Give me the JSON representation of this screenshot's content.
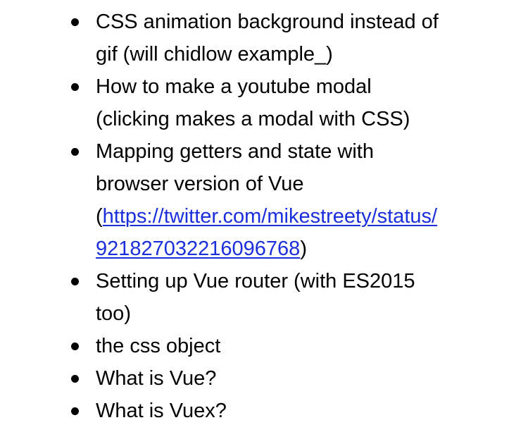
{
  "list": {
    "items": [
      {
        "lines": [
          "CSS animation background instead of",
          "gif (will chidlow example_)"
        ]
      },
      {
        "lines": [
          "How to make a youtube modal",
          "(clicking makes a modal with CSS)"
        ]
      },
      {
        "lines": [
          "Mapping getters and state with",
          "browser version of Vue"
        ],
        "link_prefix": "(",
        "link_line1": "https://twitter.com/mikestreety/status/",
        "link_line2": "921827032216096768",
        "link_suffix": ")"
      },
      {
        "lines": [
          "Setting up Vue router (with ES2015",
          "too)"
        ]
      },
      {
        "lines": [
          "the css object"
        ]
      },
      {
        "lines": [
          "What is Vue?"
        ]
      },
      {
        "lines": [
          "What is Vuex?"
        ]
      }
    ]
  },
  "colors": {
    "text": "#000000",
    "link": "#1a2edb",
    "background": "#ffffff"
  }
}
